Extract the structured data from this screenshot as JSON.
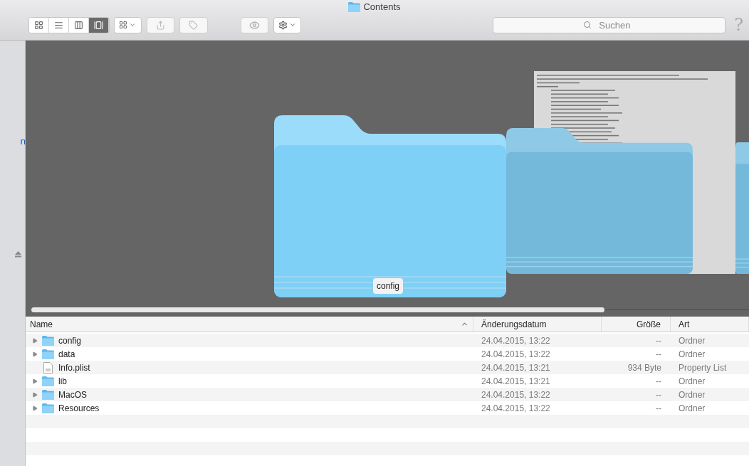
{
  "window": {
    "title": "Contents"
  },
  "toolbar": {
    "view_buttons": [
      {
        "kind": "icons",
        "selected": false
      },
      {
        "kind": "list",
        "selected": false
      },
      {
        "kind": "columns",
        "selected": false
      },
      {
        "kind": "coverflow",
        "selected": true
      }
    ],
    "search": {
      "placeholder": "Suchen"
    },
    "help": "?"
  },
  "sidebar": {
    "items": [
      {
        "label": "n"
      }
    ]
  },
  "cover_flow": {
    "caption": "config"
  },
  "table": {
    "columns": [
      {
        "label": "Name",
        "sorted": true
      },
      {
        "label": "Änderungsdatum",
        "sorted": false
      },
      {
        "label": "Größe",
        "sorted": false
      },
      {
        "label": "Art",
        "sorted": false
      }
    ],
    "rows": [
      {
        "kind": "folder",
        "name": "config",
        "date": "24.04.2015, 13:22",
        "size": "--",
        "type": "Ordner"
      },
      {
        "kind": "folder",
        "name": "data",
        "date": "24.04.2015, 13:22",
        "size": "--",
        "type": "Ordner"
      },
      {
        "kind": "file",
        "name": "Info.plist",
        "date": "24.04.2015, 13:21",
        "size": "934 Byte",
        "type": "Property List"
      },
      {
        "kind": "folder",
        "name": "lib",
        "date": "24.04.2015, 13:21",
        "size": "--",
        "type": "Ordner"
      },
      {
        "kind": "folder",
        "name": "MacOS",
        "date": "24.04.2015, 13:22",
        "size": "--",
        "type": "Ordner"
      },
      {
        "kind": "folder",
        "name": "Resources",
        "date": "24.04.2015, 13:22",
        "size": "--",
        "type": "Ordner"
      }
    ]
  }
}
